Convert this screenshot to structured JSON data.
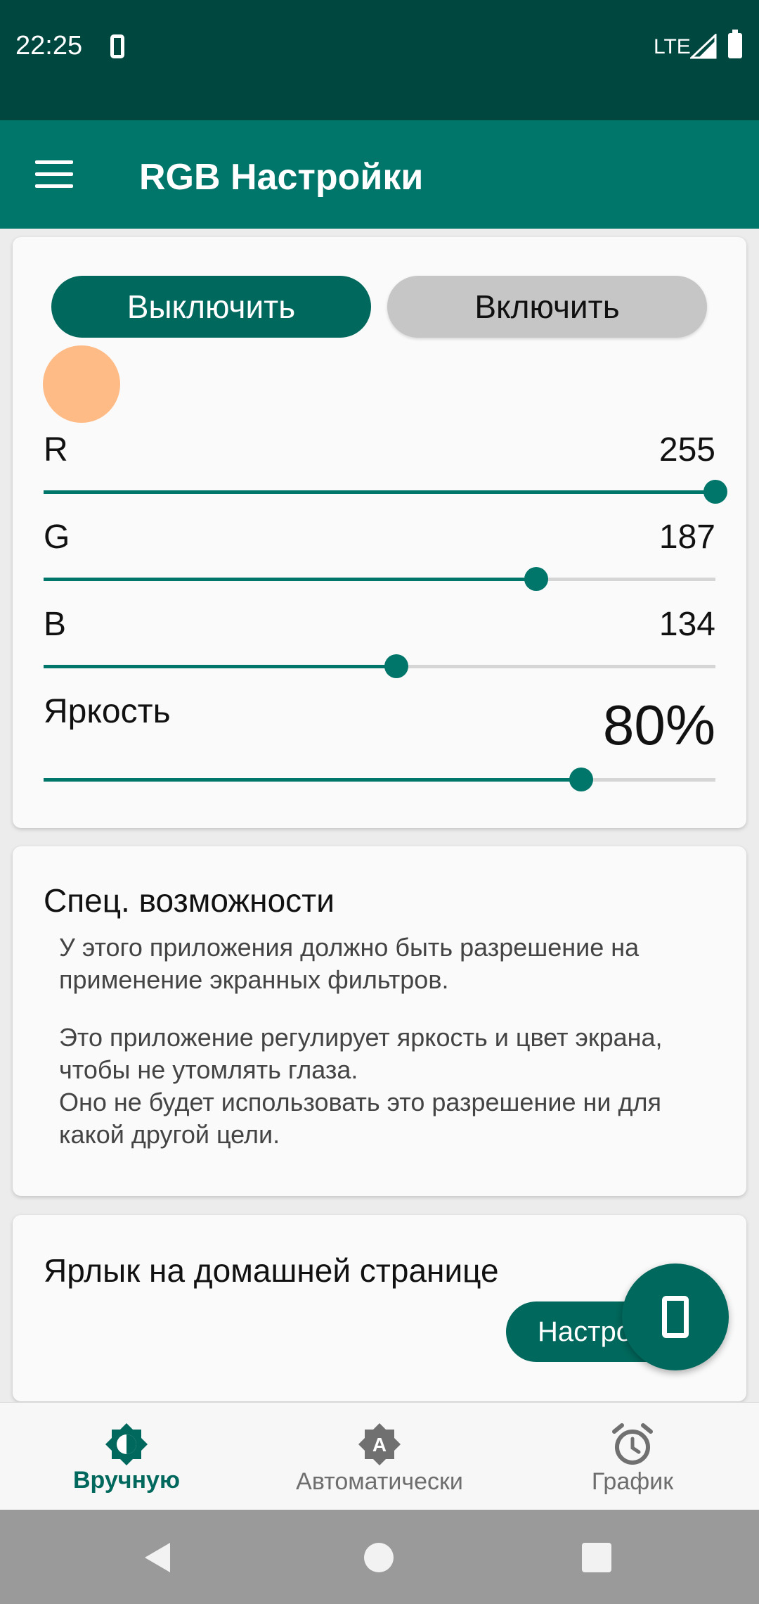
{
  "status_bar": {
    "time": "22:25",
    "network": "LTE",
    "icons": [
      "phone-icon",
      "signal-icon",
      "battery-icon"
    ]
  },
  "app_bar": {
    "title": "RGB Настройки",
    "menu_icon": "menu-icon"
  },
  "rgb_card": {
    "off_label": "Выключить",
    "on_label": "Включить",
    "preview_color": "#ffbb86",
    "sliders": [
      {
        "label": "R",
        "value": "255",
        "fraction": 1.0
      },
      {
        "label": "G",
        "value": "187",
        "fraction": 0.733
      },
      {
        "label": "B",
        "value": "134",
        "fraction": 0.525
      }
    ],
    "brightness": {
      "label": "Яркость",
      "value": "80%",
      "fraction": 0.8
    }
  },
  "accessibility_card": {
    "title": "Спец. возможности",
    "paragraph1": "У этого приложения должно быть разрешение на применение экранных фильтров.",
    "paragraph2_line1": "Это приложение регулирует яркость и цвет экрана, чтобы не утомлять глаза.",
    "paragraph2_line2": "Оно не будет использовать это разрешение ни для какой другой цели."
  },
  "shortcut_card": {
    "title": "Ярлык на домашней странице",
    "button_label": "Настро"
  },
  "bottom_nav": {
    "items": [
      {
        "label": "Вручную",
        "icon": "brightness-manual-icon",
        "active": true
      },
      {
        "label": "Автоматически",
        "icon": "brightness-auto-icon",
        "active": false
      },
      {
        "label": "График",
        "icon": "alarm-clock-icon",
        "active": false
      }
    ]
  },
  "colors": {
    "primary": "#00766a",
    "primary_dark": "#00473f",
    "accent_text": "#00685c"
  }
}
